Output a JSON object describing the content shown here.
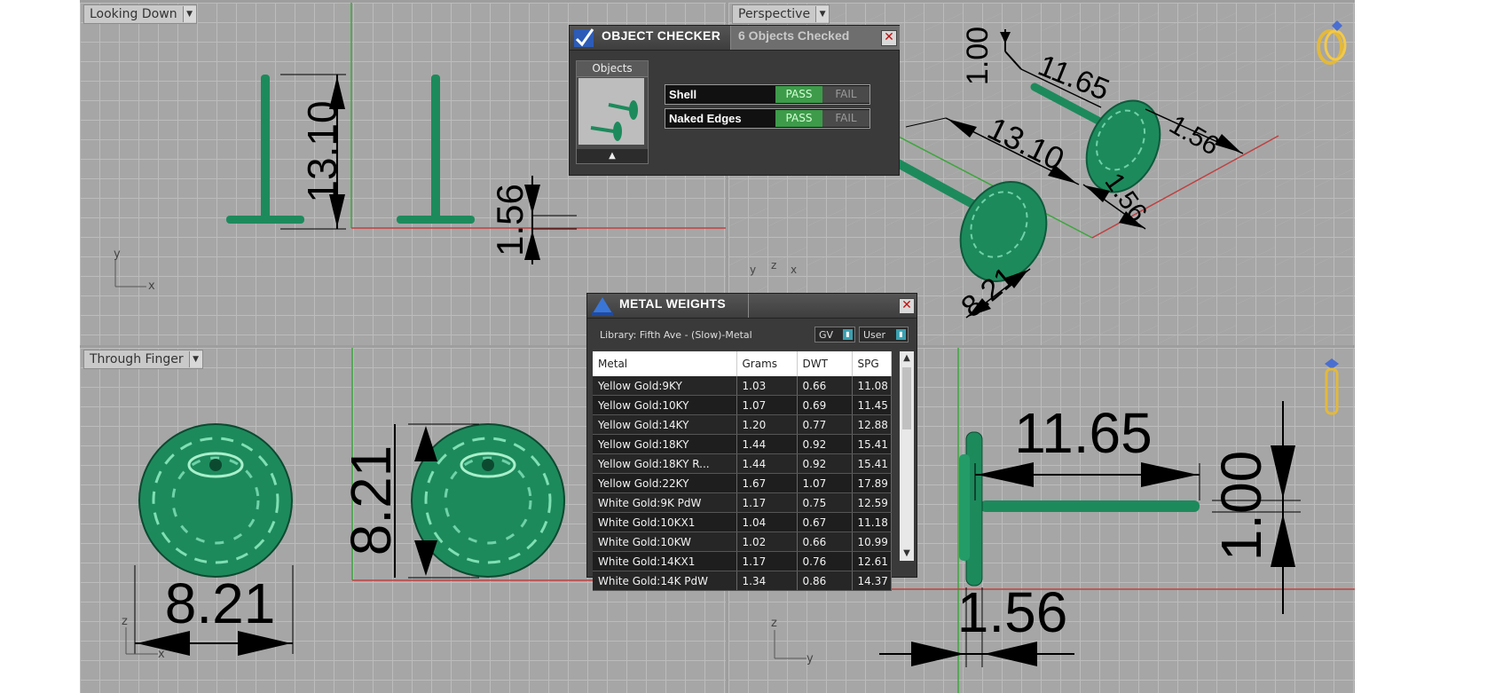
{
  "viewports": {
    "top_left": {
      "label": "Looking Down",
      "dims": [
        "13.10",
        "1.56"
      ],
      "axes": [
        "y",
        "x"
      ]
    },
    "top_right": {
      "label": "Perspective",
      "dims": [
        "1.00",
        "11.65",
        "13.10",
        "1.56",
        "1.56",
        "8.21"
      ],
      "axes": [
        "z",
        "y",
        "x"
      ]
    },
    "bottom_left": {
      "label": "Through Finger",
      "dims": [
        "8.21",
        "8.21"
      ],
      "axes": [
        "z",
        "x"
      ]
    },
    "bottom_right": {
      "label": "",
      "dims": [
        "11.65",
        "1.00",
        "1.56"
      ],
      "axes": [
        "z",
        "y"
      ]
    }
  },
  "object_checker": {
    "title": "OBJECT CHECKER",
    "status": "6  Objects Checked",
    "objects_label": "Objects",
    "up_arrow": "▲",
    "close": "✕",
    "checks": [
      {
        "label": "Shell",
        "pass": "PASS",
        "fail": "FAIL",
        "result": "pass"
      },
      {
        "label": "Naked Edges",
        "pass": "PASS",
        "fail": "FAIL",
        "result": "pass"
      }
    ]
  },
  "metal_weights": {
    "title": "METAL WEIGHTS",
    "close": "✕",
    "library": "Library: Fifth Ave - (Slow)-Metal",
    "selectors": [
      "GV",
      "User"
    ],
    "columns": [
      "Metal",
      "Grams",
      "DWT",
      "SPG"
    ],
    "rows": [
      [
        "Yellow Gold:9KY",
        "1.03",
        "0.66",
        "11.08"
      ],
      [
        "Yellow Gold:10KY",
        "1.07",
        "0.69",
        "11.45"
      ],
      [
        "Yellow Gold:14KY",
        "1.20",
        "0.77",
        "12.88"
      ],
      [
        "Yellow Gold:18KY",
        "1.44",
        "0.92",
        "15.41"
      ],
      [
        "Yellow Gold:18KY R...",
        "1.44",
        "0.92",
        "15.41"
      ],
      [
        "Yellow Gold:22KY",
        "1.67",
        "1.07",
        "17.89"
      ],
      [
        "White Gold:9K PdW",
        "1.17",
        "0.75",
        "12.59"
      ],
      [
        "White Gold:10KX1",
        "1.04",
        "0.67",
        "11.18"
      ],
      [
        "White Gold:10KW",
        "1.02",
        "0.66",
        "10.99"
      ],
      [
        "White Gold:14KX1",
        "1.17",
        "0.76",
        "12.61"
      ],
      [
        "White Gold:14K PdW",
        "1.34",
        "0.86",
        "14.37"
      ]
    ]
  },
  "colors": {
    "model": "#1d8a5c",
    "viewport_bg": "#a6a6a6",
    "panel_bg": "#3a3a3a",
    "pass": "#3d9b4a",
    "axis_x": "#c04040",
    "axis_y": "#3fa53f"
  }
}
